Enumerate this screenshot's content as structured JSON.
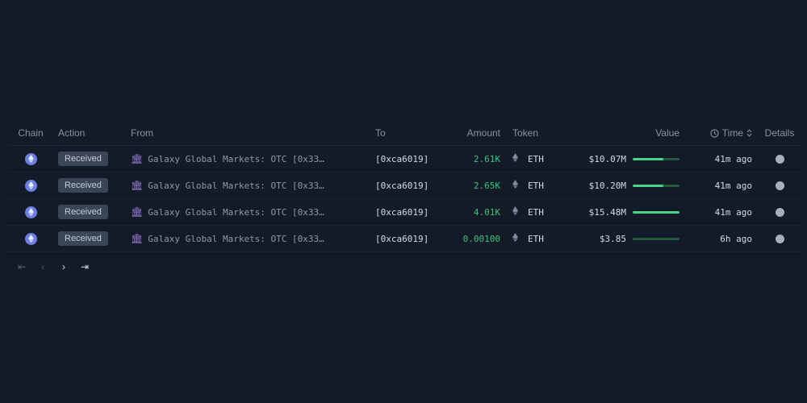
{
  "header": {
    "chain": "Chain",
    "action": "Action",
    "from": "From",
    "to": "To",
    "amount": "Amount",
    "token": "Token",
    "value": "Value",
    "time": "Time",
    "details": "Details"
  },
  "rows": [
    {
      "action": "Received",
      "from": "Galaxy Global Markets: OTC [0x33…",
      "to": "[0xca6019]",
      "amount": "2.61K",
      "token": "ETH",
      "value": "$10.07M",
      "value_level": 0.65,
      "time": "41m ago"
    },
    {
      "action": "Received",
      "from": "Galaxy Global Markets: OTC [0x33…",
      "to": "[0xca6019]",
      "amount": "2.65K",
      "token": "ETH",
      "value": "$10.20M",
      "value_level": 0.66,
      "time": "41m ago"
    },
    {
      "action": "Received",
      "from": "Galaxy Global Markets: OTC [0x33…",
      "to": "[0xca6019]",
      "amount": "4.01K",
      "token": "ETH",
      "value": "$15.48M",
      "value_level": 1.0,
      "time": "41m ago"
    },
    {
      "action": "Received",
      "from": "Galaxy Global Markets: OTC [0x33…",
      "to": "[0xca6019]",
      "amount": "0.00100",
      "token": "ETH",
      "value": "$3.85",
      "value_level": 0.0,
      "time": "6h ago"
    }
  ],
  "pagination": {
    "first": "⇤",
    "prev": "‹",
    "next": "›",
    "last": "⇥"
  },
  "icons": {
    "chain": "ethereum-chain-icon",
    "from": "bank-icon",
    "token": "eth-icon",
    "details": "info-icon",
    "time": "clock-icon",
    "sort": "sort-icon"
  },
  "colors": {
    "background": "#131b28",
    "amount": "#3fc27a",
    "bar_fill": "#4ad38a",
    "badge": "#3a4556",
    "from_icon": "#9a7cd6"
  }
}
